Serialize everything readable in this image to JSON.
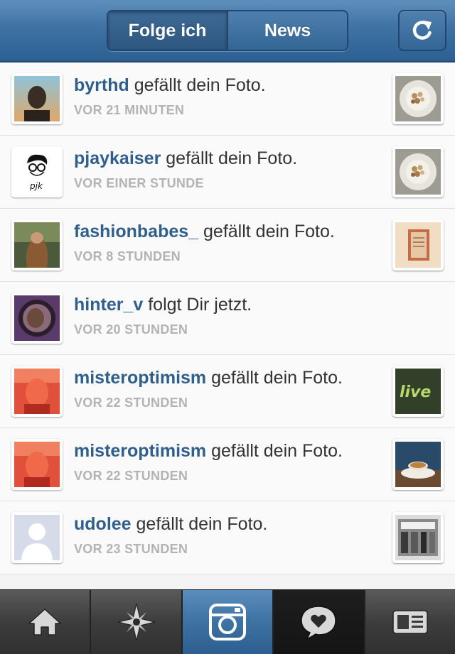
{
  "header": {
    "tabs": [
      {
        "label": "Folge ich"
      },
      {
        "label": "News"
      }
    ]
  },
  "notifications": [
    {
      "user": "byrthd",
      "action": "gefällt dein Foto.",
      "time": "VOR 21 MINUTEN"
    },
    {
      "user": "pjaykaiser",
      "action": "gefällt dein Foto.",
      "time": "VOR EINER STUNDE"
    },
    {
      "user": "fashionbabes_",
      "action": "gefällt dein Foto.",
      "time": "VOR 8 STUNDEN"
    },
    {
      "user": "hinter_v",
      "action": "folgt Dir jetzt.",
      "time": "VOR 20 STUNDEN"
    },
    {
      "user": "misteroptimism",
      "action": "gefällt dein Foto.",
      "time": "VOR 22 STUNDEN"
    },
    {
      "user": "misteroptimism",
      "action": "gefällt dein Foto.",
      "time": "VOR 22 STUNDEN"
    },
    {
      "user": "udolee",
      "action": "gefällt dein Foto.",
      "time": "VOR 23 STUNDEN"
    }
  ],
  "tabbar": {
    "items": [
      {
        "icon": "home-icon"
      },
      {
        "icon": "explore-icon"
      },
      {
        "icon": "camera-icon"
      },
      {
        "icon": "news-heart-icon"
      },
      {
        "icon": "profile-card-icon"
      }
    ]
  },
  "colors": {
    "header": "#3f73a4",
    "username": "#2f5f8a",
    "timestamp": "#b3b3b3"
  }
}
